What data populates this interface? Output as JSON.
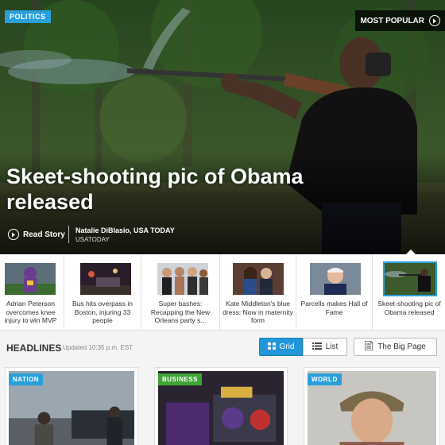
{
  "hero": {
    "section_tag": "POLITICS",
    "most_popular_label": "MOST POPULAR",
    "headline": "Skeet-shooting pic of Obama released",
    "read_story_label": "Read Story",
    "byline_author": "Natalie DiBlasio, USA TODAY",
    "byline_source": "USATODAY"
  },
  "strip": {
    "items": [
      {
        "caption": "Adrian Peterson overcomes knee injury to win MVP",
        "icon": "football-player-photo"
      },
      {
        "caption": "Bus hits overpass in Boston, injuring 33 people",
        "icon": "night-scene-photo"
      },
      {
        "caption": "Super bashes: Recapping the New Orleans party s...",
        "icon": "party-group-photo"
      },
      {
        "caption": "Kate Middleton's blue dress: Now in maternity form",
        "icon": "couple-photo"
      },
      {
        "caption": "Parcells makes Hall of Fame",
        "icon": "portrait-photo"
      },
      {
        "caption": "Skeet-shooting pic of Obama released",
        "icon": "skeet-shooting-photo"
      }
    ]
  },
  "headlines": {
    "title": "HEADLINES",
    "updated": "Updated 10:35 p.m. EST",
    "grid_label": "Grid",
    "list_label": "List",
    "big_page_label": "The Big Page"
  },
  "cards": [
    {
      "tag": "NATION",
      "tag_color": "#2aa0db"
    },
    {
      "tag": "BUSINESS",
      "tag_color": "#3fa535"
    },
    {
      "tag": "WORLD",
      "tag_color": "#2aa0db"
    }
  ],
  "colors": {
    "accent": "#2aa0db",
    "grid_button": "#2196d9"
  }
}
